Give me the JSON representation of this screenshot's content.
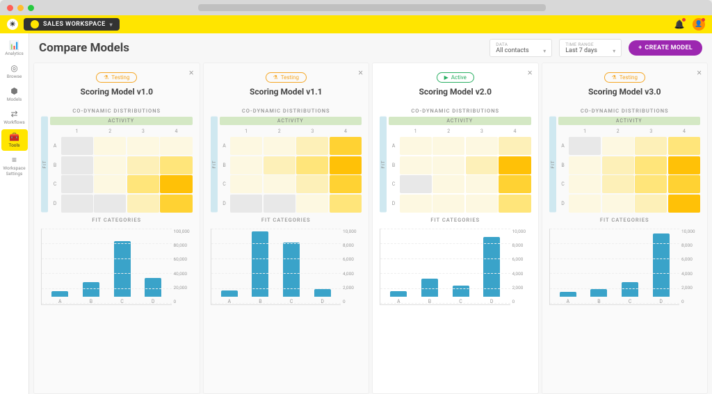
{
  "workspace_label": "SALES WORKSPACE",
  "sidebar": {
    "items": [
      {
        "icon": "📊",
        "label": "Analytics"
      },
      {
        "icon": "◎",
        "label": "Browse"
      },
      {
        "icon": "⬢",
        "label": "Models"
      },
      {
        "icon": "⇄",
        "label": "Workflows"
      },
      {
        "icon": "🧰",
        "label": "Tools"
      },
      {
        "icon": "≡",
        "label": "Workspace Settings"
      }
    ],
    "active_index": 4
  },
  "page_title": "Compare Models",
  "filters": {
    "data": {
      "label": "DATA",
      "value": "All contacts"
    },
    "time": {
      "label": "TIME RANGE",
      "value": "Last 7 days"
    }
  },
  "create_button": "CREATE MODEL",
  "section_labels": {
    "heatmap": "CO-DYNAMIC DISTRIBUTIONS",
    "bars": "FIT CATEGORIES",
    "activity": "ACTIVITY",
    "fit": "FIT"
  },
  "heatmap_axes": {
    "cols": [
      "1",
      "2",
      "3",
      "4"
    ],
    "rows": [
      "A",
      "B",
      "C",
      "D"
    ]
  },
  "status": {
    "testing": "Testing",
    "active": "Active"
  },
  "cards": [
    {
      "name": "Scoring Model v1.0",
      "status": "testing",
      "dim": true,
      "heat_classes": [
        [
          "c0",
          "c1",
          "c1",
          "c1"
        ],
        [
          "c0",
          "c1",
          "c2",
          "c3"
        ],
        [
          "c0",
          "c1",
          "c3",
          "c5"
        ],
        [
          "c0",
          "c0",
          "c2",
          "c4"
        ]
      ]
    },
    {
      "name": "Scoring Model v1.1",
      "status": "testing",
      "dim": true,
      "heat_classes": [
        [
          "c1",
          "c1",
          "c2",
          "c4"
        ],
        [
          "c1",
          "c2",
          "c3",
          "c5"
        ],
        [
          "c1",
          "c1",
          "c2",
          "c4"
        ],
        [
          "c0",
          "c0",
          "c1",
          "c3"
        ]
      ]
    },
    {
      "name": "Scoring Model v2.0",
      "status": "active",
      "dim": false,
      "heat_classes": [
        [
          "c1",
          "c1",
          "c1",
          "c2"
        ],
        [
          "c1",
          "c1",
          "c2",
          "c5"
        ],
        [
          "c0",
          "c1",
          "c1",
          "c4"
        ],
        [
          "c1",
          "c1",
          "c1",
          "c3"
        ]
      ]
    },
    {
      "name": "Scoring Model v3.0",
      "status": "testing",
      "dim": true,
      "heat_classes": [
        [
          "c0",
          "c1",
          "c2",
          "c3"
        ],
        [
          "c1",
          "c2",
          "c3",
          "c5"
        ],
        [
          "c1",
          "c2",
          "c3",
          "c4"
        ],
        [
          "c1",
          "c1",
          "c2",
          "c5"
        ]
      ]
    }
  ],
  "chart_data": [
    {
      "type": "bar",
      "title": "FIT CATEGORIES",
      "categories": [
        "A",
        "B",
        "C",
        "D"
      ],
      "values": [
        8000,
        22000,
        84000,
        28000
      ],
      "ylim": [
        0,
        100000
      ],
      "ticks": [
        "100,000",
        "80,000",
        "60,000",
        "40,000",
        "20,000",
        "0"
      ]
    },
    {
      "type": "bar",
      "title": "FIT CATEGORIES",
      "categories": [
        "A",
        "B",
        "C",
        "D"
      ],
      "values": [
        900,
        9900,
        8200,
        1200
      ],
      "ylim": [
        0,
        10000
      ],
      "ticks": [
        "10,000",
        "8,000",
        "6,000",
        "4,000",
        "2,000",
        "0"
      ]
    },
    {
      "type": "bar",
      "title": "FIT CATEGORIES",
      "categories": [
        "A",
        "B",
        "C",
        "D"
      ],
      "values": [
        800,
        2700,
        1700,
        9000
      ],
      "ylim": [
        0,
        10000
      ],
      "ticks": [
        "10,000",
        "8,000",
        "6,000",
        "4,000",
        "2,000",
        "0"
      ]
    },
    {
      "type": "bar",
      "title": "FIT CATEGORIES",
      "categories": [
        "A",
        "B",
        "C",
        "D"
      ],
      "values": [
        700,
        1200,
        2200,
        9600
      ],
      "ylim": [
        0,
        10000
      ],
      "ticks": [
        "10,000",
        "8,000",
        "6,000",
        "4,000",
        "2,000",
        "0"
      ]
    }
  ]
}
